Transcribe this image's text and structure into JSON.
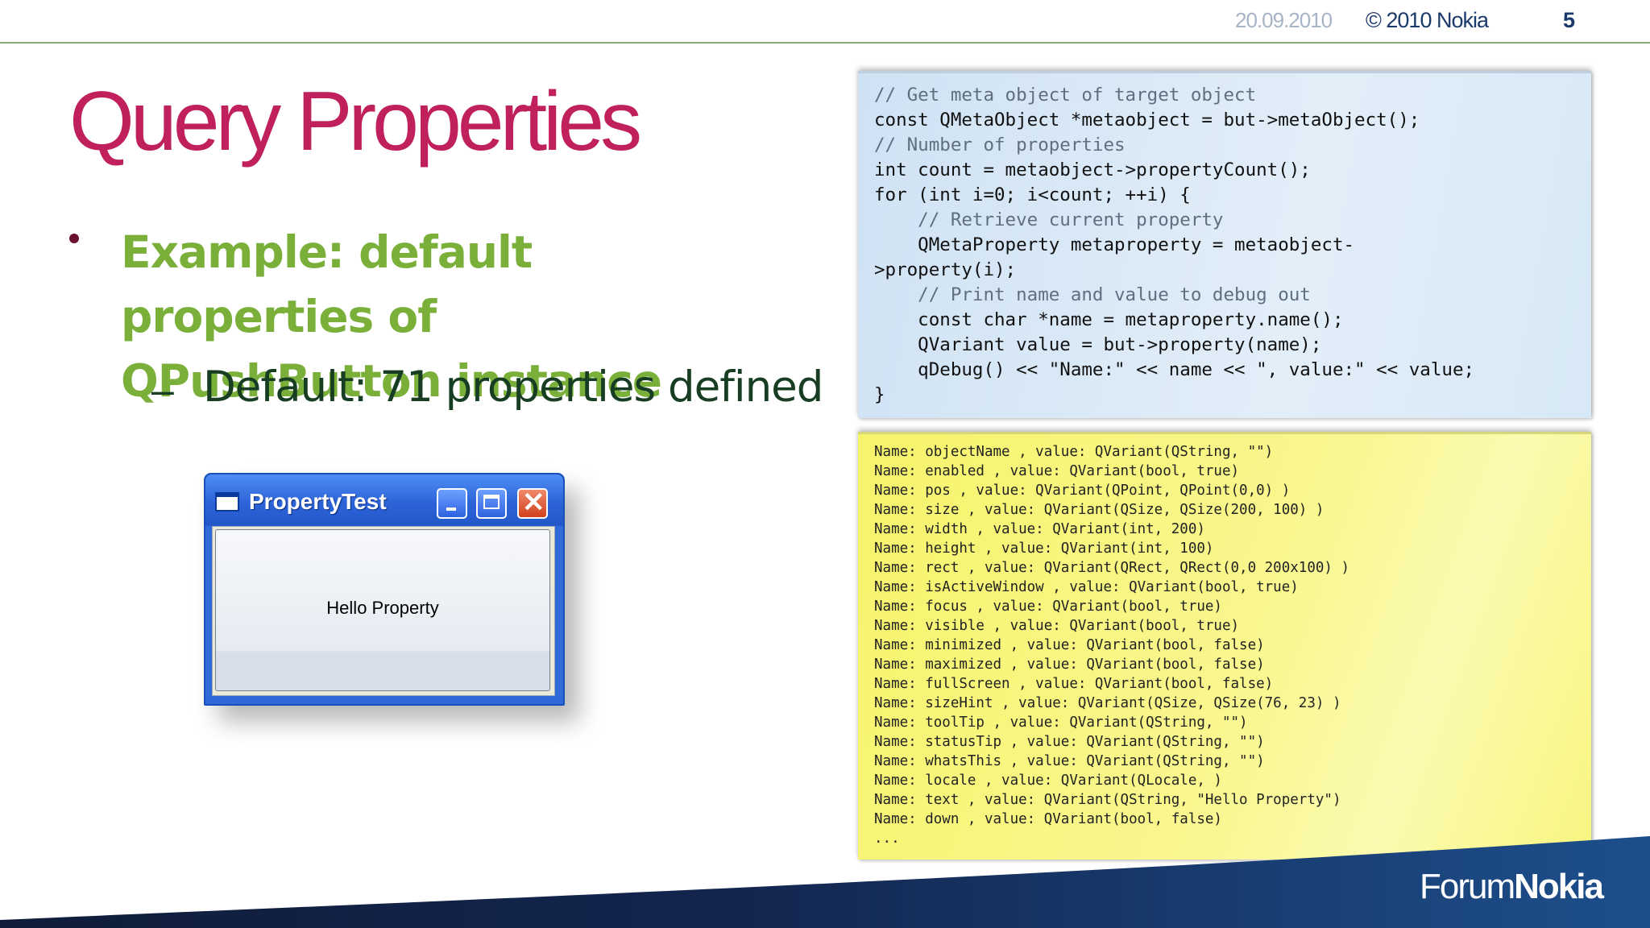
{
  "header": {
    "date": "20.09.2010",
    "copyright": "© 2010 Nokia",
    "page": "5"
  },
  "title": "Query Properties",
  "bullet": "Example: default properties of QPushButton instance",
  "sub_bullet_dash": "–",
  "sub_bullet": "Default: 71 properties defined",
  "window": {
    "title": "PropertyTest",
    "button_label": "Hello Property",
    "title_color": "#2c64d8"
  },
  "code": {
    "lines": [
      "// Get meta object of target object",
      "const QMetaObject *metaobject = but->metaObject();",
      "// Number of properties",
      "int count = metaobject->propertyCount();",
      "for (int i=0; i<count; ++i) {",
      "    // Retrieve current property",
      "    QMetaProperty metaproperty = metaobject-",
      ">property(i);",
      "    // Print name and value to debug out",
      "    const char *name = metaproperty.name();",
      "    QVariant value = but->property(name);",
      "    qDebug() << \"Name:\" << name << \", value:\" << value;",
      "}"
    ]
  },
  "output": {
    "lines": [
      "Name: objectName , value: QVariant(QString, \"\")",
      "Name: enabled , value: QVariant(bool, true)",
      "Name: pos , value: QVariant(QPoint, QPoint(0,0) )",
      "Name: size , value: QVariant(QSize, QSize(200, 100) )",
      "Name: width , value: QVariant(int, 200)",
      "Name: height , value: QVariant(int, 100)",
      "Name: rect , value: QVariant(QRect, QRect(0,0 200x100) )",
      "Name: isActiveWindow , value: QVariant(bool, true)",
      "Name: focus , value: QVariant(bool, true)",
      "Name: visible , value: QVariant(bool, true)",
      "Name: minimized , value: QVariant(bool, false)",
      "Name: maximized , value: QVariant(bool, false)",
      "Name: fullScreen , value: QVariant(bool, false)",
      "Name: sizeHint , value: QVariant(QSize, QSize(76, 23) )",
      "Name: toolTip , value: QVariant(QString, \"\")",
      "Name: statusTip , value: QVariant(QString, \"\")",
      "Name: whatsThis , value: QVariant(QString, \"\")",
      "Name: locale , value: QVariant(QLocale, )",
      "Name: text , value: QVariant(QString, \"Hello Property\")",
      "Name: down , value: QVariant(bool, false)",
      "..."
    ]
  },
  "footer": {
    "logo_regular": "Forum",
    "logo_bold": "Nokia"
  },
  "colors": {
    "title": "#c0205b",
    "bullet": "#7ab03a",
    "sub_bullet": "#173d22",
    "footer_dark": "#101c3a",
    "footer_blue": "#1d4f8c"
  }
}
